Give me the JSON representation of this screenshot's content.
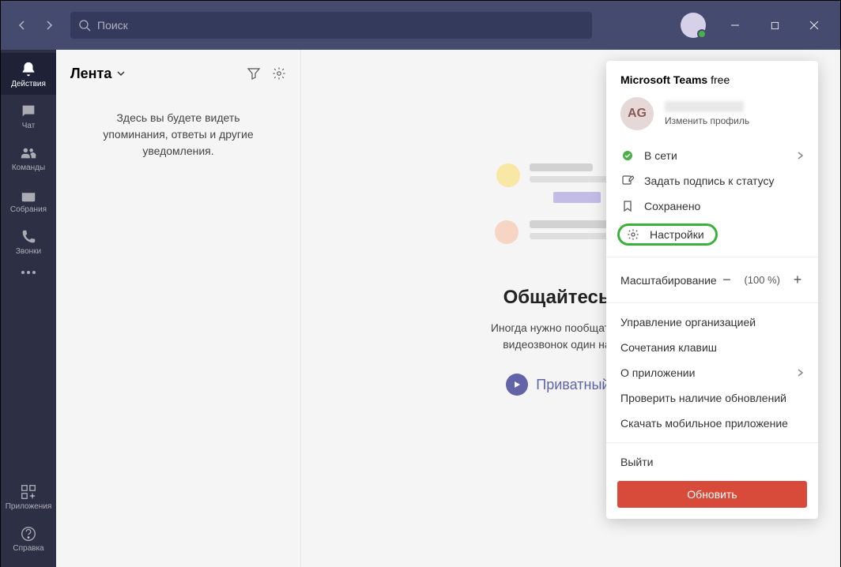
{
  "search": {
    "placeholder": "Поиск"
  },
  "sidebar": {
    "items": [
      {
        "label": "Действия"
      },
      {
        "label": "Чат"
      },
      {
        "label": "Команды"
      },
      {
        "label": "Собрания"
      },
      {
        "label": "Звонки"
      }
    ],
    "apps": "Приложения",
    "help": "Справка"
  },
  "left_panel": {
    "title": "Лента",
    "empty_message": "Здесь вы будете видеть упоминания, ответы и другие уведомления."
  },
  "content": {
    "heading": "Общайтесь пр",
    "subtitle_line1": "Иногда нужно пообщаться в ча",
    "subtitle_line2": "видеозвонок один на один",
    "private_chat": "Приватный чат"
  },
  "popup": {
    "app_name": "Microsoft Teams",
    "plan": " free",
    "avatar_initials": "AG",
    "edit_profile": "Изменить профиль",
    "status": "В сети",
    "set_status": "Задать подпись к статусу",
    "saved": "Сохранено",
    "settings": "Настройки",
    "zoom_label": "Масштабирование",
    "zoom_value": "(100 %)",
    "manage_org": "Управление организацией",
    "shortcuts": "Сочетания клавиш",
    "about": "О приложении",
    "check_updates": "Проверить наличие обновлений",
    "download_mobile": "Скачать мобильное приложение",
    "sign_out": "Выйти",
    "upgrade": "Обновить"
  }
}
